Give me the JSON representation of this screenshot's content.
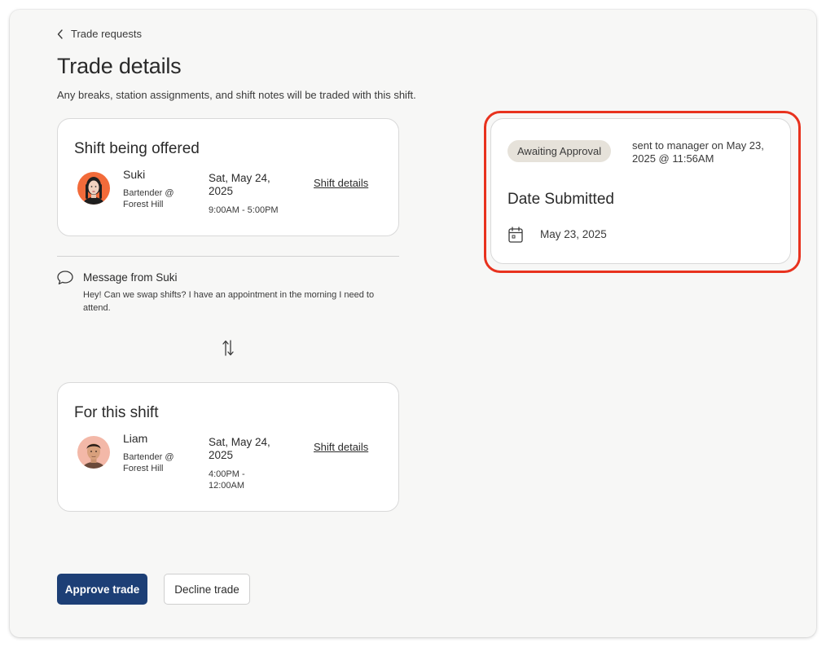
{
  "breadcrumb": {
    "label": "Trade requests"
  },
  "page": {
    "title": "Trade details",
    "subtitle": "Any breaks, station assignments, and shift notes will be traded with this shift."
  },
  "offered_shift": {
    "title": "Shift being offered",
    "name": "Suki",
    "role": "Bartender @ Forest Hill",
    "date": "Sat, May 24, 2025",
    "time": "9:00AM - 5:00PM",
    "link": "Shift details"
  },
  "message": {
    "title": "Message from Suki",
    "body": "Hey! Can we swap shifts? I have an appointment in the morning I need to attend."
  },
  "target_shift": {
    "title": "For this shift",
    "name": "Liam",
    "role": "Bartender @ Forest Hill",
    "date": "Sat, May 24, 2025",
    "time": "4:00PM - 12:00AM",
    "link": "Shift details"
  },
  "status": {
    "badge": "Awaiting Approval",
    "sent_text": "sent to manager on May 23, 2025 @ 11:56AM",
    "date_submitted_title": "Date Submitted",
    "date_submitted_value": "May 23, 2025"
  },
  "actions": {
    "approve": "Approve trade",
    "decline": "Decline trade"
  },
  "colors": {
    "primary": "#1d3f76",
    "badge_bg": "#e6e2da",
    "highlight": "#e8321e"
  },
  "icons": [
    "chevron-left-icon",
    "speech-bubble-icon",
    "swap-arrows-icon",
    "calendar-icon"
  ]
}
